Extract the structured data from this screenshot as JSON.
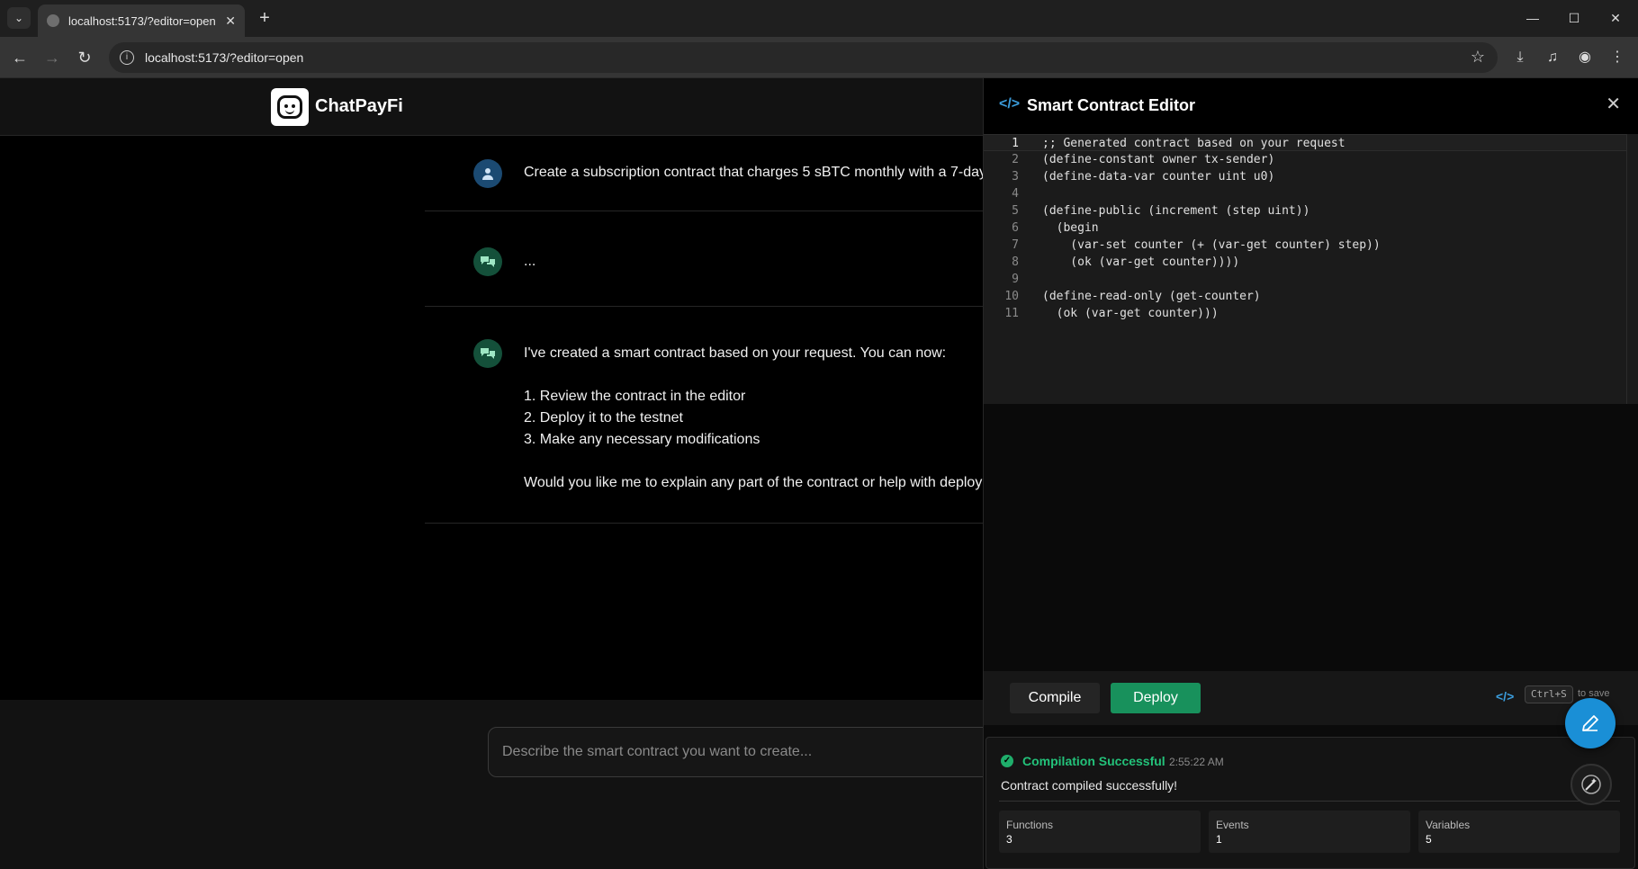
{
  "browser": {
    "tab_title": "localhost:5173/?editor=open",
    "url": "localhost:5173/?editor=open"
  },
  "app": {
    "title": "ChatPayFi"
  },
  "chat": {
    "messages": [
      {
        "role": "user",
        "lines": [
          "Create a subscription contract that charges 5 sBTC monthly with a 7-day"
        ]
      },
      {
        "role": "assistant",
        "lines": [
          "..."
        ]
      },
      {
        "role": "assistant",
        "lines": [
          "I've created a smart contract based on your request. You can now:",
          "",
          "1. Review the contract in the editor",
          "2. Deploy it to the testnet",
          "3. Make any necessary modifications",
          "",
          "Would you like me to explain any part of the contract or help with deploy"
        ]
      }
    ],
    "input_placeholder": "Describe the smart contract you want to create..."
  },
  "editor": {
    "title": "Smart Contract Editor",
    "code_lines": [
      ";; Generated contract based on your request",
      "(define-constant owner tx-sender)",
      "(define-data-var counter uint u0)",
      "",
      "(define-public (increment (step uint))",
      "  (begin",
      "    (var-set counter (+ (var-get counter) step))",
      "    (ok (var-get counter))))",
      "",
      "(define-read-only (get-counter)",
      "  (ok (var-get counter)))"
    ],
    "line_numbers": [
      "1",
      "2",
      "3",
      "4",
      "5",
      "6",
      "7",
      "8",
      "9",
      "10",
      "11"
    ],
    "compile_label": "Compile",
    "deploy_label": "Deploy",
    "shortcut_key": "Ctrl+S",
    "shortcut_hint": "to save",
    "result": {
      "status": "Compilation Successful",
      "time": "2:55:22 AM",
      "message": "Contract compiled successfully!",
      "stats": [
        {
          "label": "Functions",
          "value": "3"
        },
        {
          "label": "Events",
          "value": "1"
        },
        {
          "label": "Variables",
          "value": "5"
        }
      ]
    }
  },
  "colors": {
    "accent_blue": "#1a8fd6",
    "deploy_green": "#18915c",
    "success_green": "#23c27a"
  }
}
